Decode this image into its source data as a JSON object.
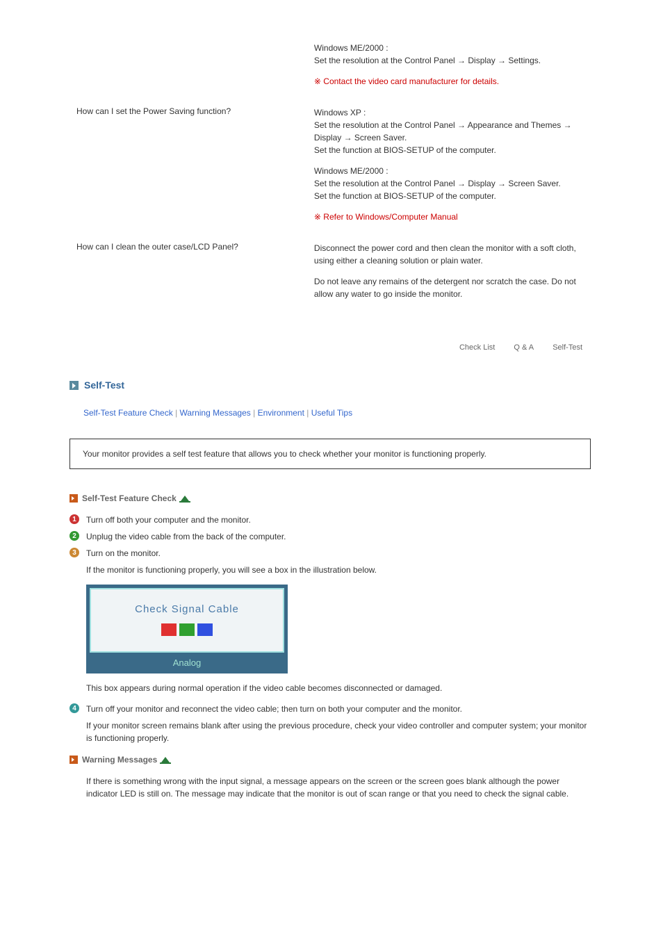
{
  "qa": {
    "r0": {
      "a1": "Windows ME/2000 :\nSet the resolution at the Control Panel → Display → Settings.",
      "note": "※ Contact the video card manufacturer for details."
    },
    "r1": {
      "q": "How can I set the Power Saving function?",
      "a1": "Windows XP :\nSet the resolution at the Control Panel → Appearance and Themes → Display → Screen Saver.\nSet the function at BIOS-SETUP of the computer.",
      "a2": "Windows ME/2000 :\nSet the resolution at the Control Panel → Display → Screen Saver.\nSet the function at BIOS-SETUP of the computer.",
      "note": "※ Refer to Windows/Computer Manual"
    },
    "r2": {
      "q": "How can I clean the outer case/LCD Panel?",
      "a1": "Disconnect the power cord and then clean the monitor with a soft cloth, using either a cleaning solution or plain water.",
      "a2": "Do not leave any remains of the detergent nor scratch the case. Do not allow any water to go inside the monitor."
    }
  },
  "nav": {
    "checklist": "Check List",
    "qa": "Q & A",
    "selftest": "Self-Test"
  },
  "section": {
    "title": "Self-Test"
  },
  "sublinks": {
    "l1": "Self-Test Feature Check",
    "l2": "Warning Messages",
    "l3": "Environment",
    "l4": "Useful Tips",
    "sep": "  |  "
  },
  "infobox": "Your monitor provides a self test feature that allows you to check whether your monitor is functioning properly.",
  "selftest": {
    "heading": "Self-Test Feature Check",
    "s1": "Turn off both your computer and the monitor.",
    "s2": "Unplug the video cable from the back of the computer.",
    "s3": "Turn on the monitor.",
    "s3a": "If the monitor is functioning properly, you will see a box in the illustration below.",
    "signal_text": "Check Signal Cable",
    "signal_footer": "Analog",
    "s3b": "This box appears during normal operation if the video cable becomes disconnected or damaged.",
    "s4": "Turn off your monitor and reconnect the video cable; then turn on both your computer and the monitor.",
    "s4a": "If your monitor screen remains blank after using the previous procedure, check your video controller and computer system; your monitor is functioning properly."
  },
  "warning": {
    "heading": "Warning Messages",
    "p1": "If there is something wrong with the input signal, a message appears on the screen or the screen goes blank although the power indicator LED is still on. The message may indicate that the monitor is out of scan range or that you need to check the signal cable."
  }
}
